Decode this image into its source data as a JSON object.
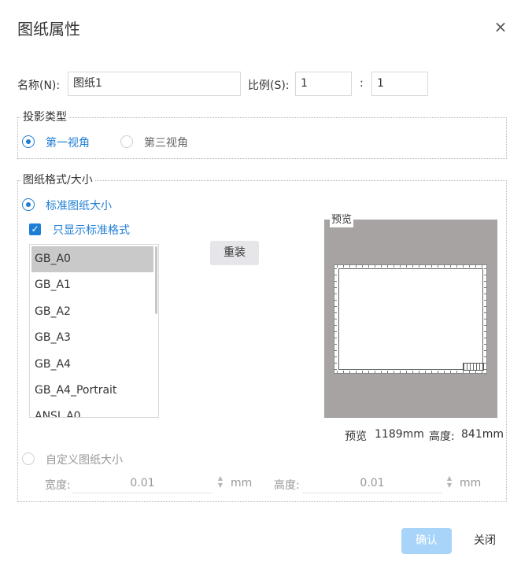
{
  "dialog": {
    "title": "图纸属性",
    "close_icon": "close-icon"
  },
  "name_row": {
    "name_label": "名称(N):",
    "name_value": "图纸1",
    "scale_label": "比例(S):",
    "scale_left": "1",
    "scale_sep": ":",
    "scale_right": "1"
  },
  "projection": {
    "legend": "投影类型",
    "options": [
      {
        "label": "第一视角",
        "checked": true
      },
      {
        "label": "第三视角",
        "checked": false
      }
    ]
  },
  "format": {
    "legend": "图纸格式/大小",
    "standard_label": "标准图纸大小",
    "only_standard_label": "只显示标准格式",
    "only_standard_checked": true,
    "sheet_list": [
      "GB_A0",
      "GB_A1",
      "GB_A2",
      "GB_A3",
      "GB_A4",
      "GB_A4_Portrait",
      "ANSI_A0"
    ],
    "selected_index": 0,
    "reload_button": "重装",
    "preview_label": "预览",
    "preview_info_label": "预览",
    "width_value": "1189mm",
    "height_label": "高度:",
    "height_value": "841mm",
    "custom_label": "自定义图纸大小",
    "custom_width_label": "宽度:",
    "custom_width_value": "0.01",
    "custom_width_unit": "mm",
    "custom_height_label": "高度:",
    "custom_height_value": "0.01",
    "custom_height_unit": "mm"
  },
  "footer": {
    "ok_button": "确认",
    "close_button": "关闭"
  },
  "colors": {
    "accent": "#1e7ed6",
    "ok_disabled": "#a8d4fa",
    "preview_bg": "#a7a3a3",
    "selected_row": "#c9c9c9"
  }
}
